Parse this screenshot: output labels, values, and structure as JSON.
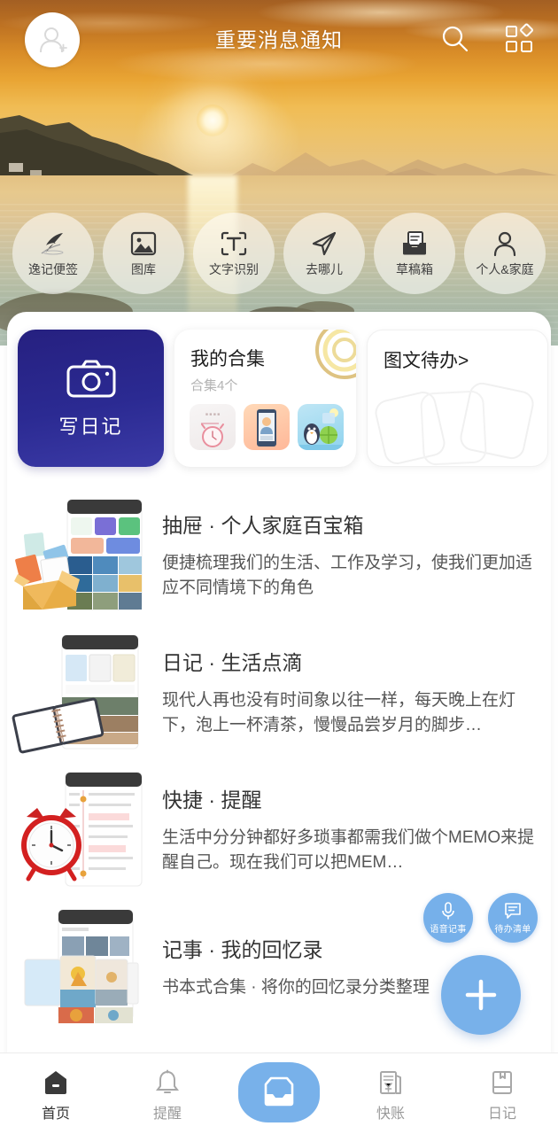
{
  "header": {
    "title": "重要消息通知",
    "avatar_icon": "user-add-avatar-icon",
    "search_icon": "search-icon",
    "grid_icon": "grid-apps-icon"
  },
  "quick_actions": [
    {
      "label": "逸记便签",
      "icon": "feather-pen-icon"
    },
    {
      "label": "图库",
      "icon": "photo-gallery-icon"
    },
    {
      "label": "文字识别",
      "icon": "text-recognition-icon"
    },
    {
      "label": "去哪儿",
      "icon": "paper-plane-icon"
    },
    {
      "label": "草稿箱",
      "icon": "draft-inbox-icon"
    },
    {
      "label": "个人&家庭",
      "icon": "person-icon"
    }
  ],
  "cards": {
    "write": {
      "label": "写日记",
      "icon": "camera-icon"
    },
    "collection": {
      "title": "我的合集",
      "subtitle": "合集4个",
      "thumbnails": [
        "alarm-clock-thumbnail",
        "phone-person-thumbnail",
        "penguin-scene-thumbnail"
      ]
    },
    "todo": {
      "title": "图文待办>"
    }
  },
  "list": [
    {
      "title": "抽屉 · 个人家庭百宝箱",
      "desc": "便捷梳理我们的生活、工作及学习，使我们更加适应不同情境下的角色",
      "illustration": "box-with-phone-grid-illustration"
    },
    {
      "title": "日记 · 生活点滴",
      "desc": "现代人再也没有时间象以往一样，每天晚上在灯下，泡上一杯清茶，慢慢品尝岁月的脚步…",
      "illustration": "notebook-with-phone-illustration"
    },
    {
      "title": "快捷 · 提醒",
      "desc": "生活中分分钟都好多琐事都需我们做个MEMO来提醒自己。现在我们可以把MEM…",
      "illustration": "alarm-clock-with-phone-illustration"
    },
    {
      "title": "记事 · 我的回忆录",
      "desc": "书本式合集 · 将你的回忆录分类整理",
      "illustration": "photo-cards-phone-illustration"
    }
  ],
  "fabs": {
    "voice": {
      "label": "语音记事",
      "icon": "microphone-icon"
    },
    "todo": {
      "label": "待办清单",
      "icon": "chat-list-icon"
    },
    "main": {
      "label": "+",
      "icon": "plus-icon"
    }
  },
  "bottom_nav": [
    {
      "label": "首页",
      "icon": "home-icon",
      "active": true
    },
    {
      "label": "提醒",
      "icon": "bell-icon",
      "active": false
    },
    {
      "label": "",
      "icon": "inbox-icon",
      "active": true
    },
    {
      "label": "快账",
      "icon": "account-icon",
      "active": false
    },
    {
      "label": "日记",
      "icon": "book-icon",
      "active": false
    }
  ],
  "colors": {
    "accent_blue": "#78b1ea",
    "card_indigo": "#2b2a92",
    "nav_active": "#333333",
    "nav_inactive": "#9a9a9a"
  }
}
